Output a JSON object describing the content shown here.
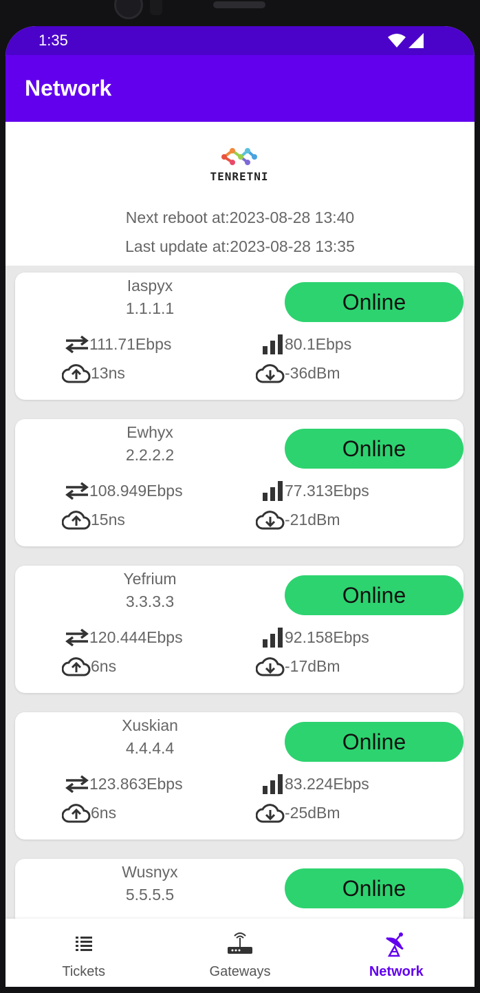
{
  "status_bar": {
    "time": "1:35"
  },
  "app_bar": {
    "title": "Network"
  },
  "header": {
    "logo_text": "TENRETNI",
    "next_reboot": "Next reboot at:2023-08-28 13:40",
    "last_update": "Last update at:2023-08-28 13:35"
  },
  "devices": [
    {
      "name": "Iaspyx",
      "ip": "1.1.1.1",
      "status": "Online",
      "throughput": "111.71Ebps",
      "signal": "80.1Ebps",
      "latency": "13ns",
      "rssi": "-36dBm"
    },
    {
      "name": "Ewhyx",
      "ip": "2.2.2.2",
      "status": "Online",
      "throughput": "108.949Ebps",
      "signal": "77.313Ebps",
      "latency": "15ns",
      "rssi": "-21dBm"
    },
    {
      "name": "Yefrium",
      "ip": "3.3.3.3",
      "status": "Online",
      "throughput": "120.444Ebps",
      "signal": "92.158Ebps",
      "latency": "6ns",
      "rssi": "-17dBm"
    },
    {
      "name": "Xuskian",
      "ip": "4.4.4.4",
      "status": "Online",
      "throughput": "123.863Ebps",
      "signal": "83.224Ebps",
      "latency": "6ns",
      "rssi": "-25dBm"
    },
    {
      "name": "Wusnyx",
      "ip": "5.5.5.5",
      "status": "Online"
    }
  ],
  "bottom_nav": [
    {
      "label": "Tickets",
      "icon": "list-icon"
    },
    {
      "label": "Gateways",
      "icon": "router-icon"
    },
    {
      "label": "Network",
      "icon": "satellite-dish-icon",
      "active": true
    }
  ],
  "colors": {
    "primary": "#6200ee",
    "status_bar": "#4b02c9",
    "online": "#2dd36f"
  }
}
